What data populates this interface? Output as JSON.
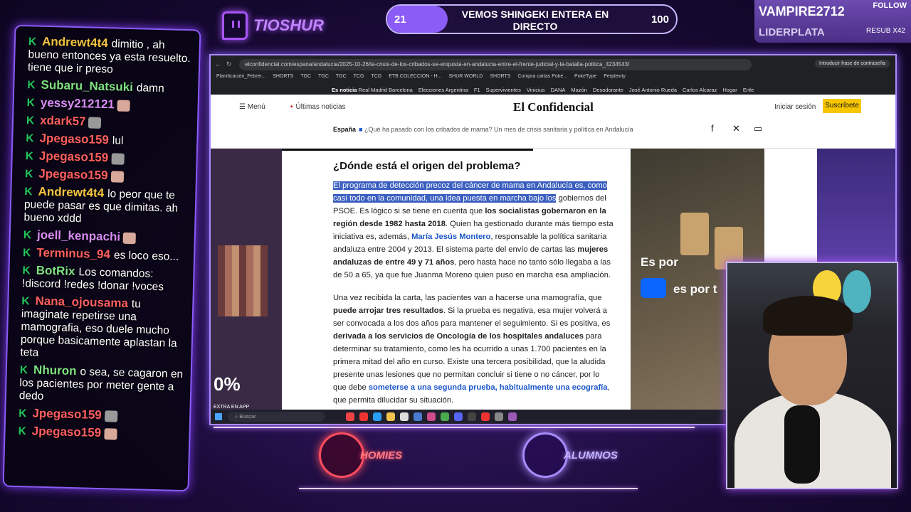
{
  "chat": {
    "messages": [
      {
        "user": "Andrewt4t4",
        "color": "#f4c542",
        "text": "dimitio , ah bueno entonces ya esta resuelto. tiene que ir preso"
      },
      {
        "user": "Subaru_Natsuki",
        "color": "#7ee081",
        "text": "damn"
      },
      {
        "user": "yessy212121",
        "color": "#d88cf5",
        "text": ""
      },
      {
        "user": "xdark57",
        "color": "#ff5f5f",
        "text": ""
      },
      {
        "user": "Jpegaso159",
        "color": "#ff5f5f",
        "text": "lul"
      },
      {
        "user": "Jpegaso159",
        "color": "#ff5f5f",
        "text": ""
      },
      {
        "user": "Jpegaso159",
        "color": "#ff5f5f",
        "text": ""
      },
      {
        "user": "Andrewt4t4",
        "color": "#f4c542",
        "text": "lo peor que te puede pasar es que dimitas. ah bueno xddd"
      },
      {
        "user": "joell_kenpachi",
        "color": "#d88cf5",
        "text": ""
      },
      {
        "user": "Terminus_94",
        "color": "#ff5f5f",
        "text": "es loco eso..."
      },
      {
        "user": "BotRix",
        "color": "#7ee081",
        "text": "Los comandos: !discord !redes !donar !voces"
      },
      {
        "user": "Nana_ojousama",
        "color": "#ff5f5f",
        "text": "tu imaginate repetirse una mamografia, eso duele mucho porque basicamente aplastan la teta"
      },
      {
        "user": "Nhuron",
        "color": "#7ee081",
        "text": "o sea, se cagaron en los pacientes por meter gente a dedo"
      },
      {
        "user": "Jpegaso159",
        "color": "#ff5f5f",
        "text": ""
      },
      {
        "user": "Jpegaso159",
        "color": "#ff5f5f",
        "text": ""
      }
    ],
    "badge": "K"
  },
  "brand": {
    "name": "TIOSHUR"
  },
  "goal": {
    "current": "21",
    "target": "100",
    "title": "VEMOS SHINGEKI ENTERA EN DIRECTO",
    "progress": 0.21
  },
  "follow": {
    "name": "VAMPIRE2712",
    "label": "FOLLOW",
    "sub": "LIDERPLATA",
    "resub": "RESUB X42"
  },
  "browser": {
    "url": "elconfidencial.com/espana/andalucia/2025-10-26/la-crisis-de-los-cribados-se-enquista-en-andalucia-entre-el-frente-judicial-y-la-batalla-politica_4234543/",
    "profile": "Introducir frase de contraseña",
    "bookmarks": [
      "Planificación_Febrer...",
      "SHORTS",
      "TGC",
      "TGC",
      "TGC",
      "TCG",
      "TCG",
      "ETB COLECCION - H...",
      "SHUR WORLD",
      "SHORTS",
      "Compra cartas Poke...",
      "PokeType",
      "Perplexity"
    ],
    "trend_label": "Es noticia",
    "trends": [
      "Real Madrid Barcelona",
      "Elecciones Argentina",
      "F1",
      "Supervivientes",
      "Vinicius",
      "DANA",
      "Mazón",
      "Desodorante",
      "José Antonio Rueda",
      "Carlos Alcaraz",
      "Hogar",
      "Enfe"
    ],
    "menu": "Menú",
    "latest": "Últimas noticias",
    "site": "El Confidencial",
    "login": "Iniciar sesión",
    "subscribe": "Suscríbete",
    "section": "España",
    "subtitle": "¿Qué ha pasado con los cribados de mama? Un mes de crisis sanitaria y política en Andalucía",
    "heading": "¿Dónde está el origen del problema?",
    "p1_hl": "El programa de detección precoz del cáncer de mama en Andalucía es, como casi todo en la comunidad, una idea puesta en marcha bajo los",
    "p1_a": " gobiernos del PSOE. Es lógico si se tiene en cuenta que ",
    "p1_b": "los socialistas gobernaron en la región desde 1982 hasta 2018",
    "p1_c": ". Quien ha gestionado durante más tiempo esta iniciativa es, además, ",
    "p1_link": "María Jesús Montero",
    "p1_d": ", responsable la política sanitaria andaluza entre 2004 y 2013. El sistema parte del envío de cartas las ",
    "p1_e": "mujeres andaluzas de entre 49 y 71 años",
    "p1_f": ", pero hasta hace no tanto sólo llegaba a las de 50 a 65, ya que fue Juanma Moreno quien puso en marcha esa ampliación.",
    "p2_a": "Una vez recibida la carta, las pacientes van a hacerse una mamografía, que ",
    "p2_b": "puede arrojar tres resultados",
    "p2_c": ". Si la prueba es negativa, esa mujer volverá a ser convocada a los dos años para mantener el seguimiento. Si es positiva, es ",
    "p2_d": "derivada a los servicios de Oncología de los hospitales andaluces",
    "p2_e": " para determinar su tratamiento, como les ha ocurrido a unas 1.700 pacientes en la primera mitad del año en curso. Existe una tercera posibilidad, que la aludida presente unas lesiones que no permitan concluir si tiene o no cáncer, por lo que debe ",
    "p2_link": "someterse a una segunda prueba, habitualmente una ecografía",
    "p2_f": ", que permita dilucidar su situación.",
    "ad_left_pct": "0%",
    "ad_left_small": "EXTRA EN APP",
    "ad_right_1": "Es por",
    "ad_right_2": "es por t",
    "search": "Buscar"
  },
  "badges": {
    "homies": "HOMIES",
    "alumnos": "ALUMNOS"
  }
}
